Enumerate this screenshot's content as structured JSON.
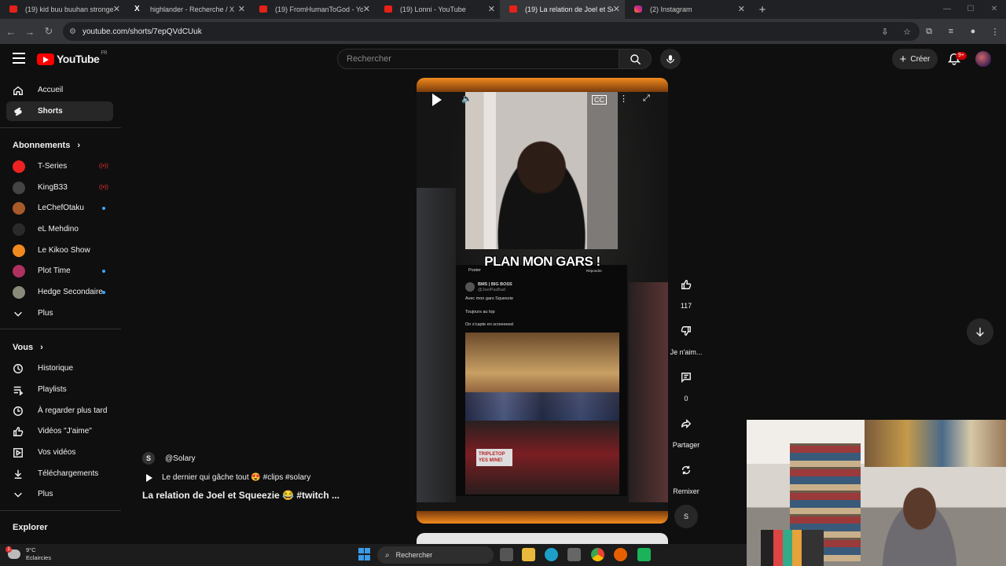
{
  "browser": {
    "tabs": [
      {
        "label": "(19) kid buu buuhan stronger -",
        "favicon": "youtube-icon",
        "active": false
      },
      {
        "label": "highlander - Recherche / X",
        "favicon": "x-icon",
        "active": false
      },
      {
        "label": "(19) FromHumanToGod - YouTu",
        "favicon": "youtube-icon",
        "active": false
      },
      {
        "label": "(19) Lonni - YouTube",
        "favicon": "youtube-icon",
        "active": false
      },
      {
        "label": "(19) La relation de Joel et Sque",
        "favicon": "youtube-icon",
        "active": true
      },
      {
        "label": "(2) Instagram",
        "favicon": "instagram-icon",
        "active": false
      }
    ],
    "new_tab_glyph": "+",
    "url": "youtube.com/shorts/7epQVdCUuk"
  },
  "header": {
    "logo_text": "YouTube",
    "country_code": "FR",
    "search_placeholder": "Rechercher",
    "create_label": "Créer",
    "notification_badge": "9+"
  },
  "sidebar": {
    "main": [
      {
        "label": "Accueil",
        "icon": "home-icon"
      },
      {
        "label": "Shorts",
        "icon": "shorts-icon",
        "active": true
      }
    ],
    "subscriptions_title": "Abonnements",
    "subscriptions": [
      {
        "label": "T-Series",
        "status": "live",
        "color": "#e22"
      },
      {
        "label": "KingB33",
        "status": "live",
        "color": "#444"
      },
      {
        "label": "LeChefOtaku",
        "status": "new",
        "color": "#a85a2a"
      },
      {
        "label": "eL Mehdino",
        "status": "",
        "color": "#2a2a2a"
      },
      {
        "label": "Le Kikoo Show",
        "status": "",
        "color": "#f08a1e"
      },
      {
        "label": "Plot Time",
        "status": "new",
        "color": "#b03060"
      },
      {
        "label": "Hedge Secondaire",
        "status": "new",
        "color": "#8a8a7a"
      }
    ],
    "subscriptions_more": "Plus",
    "you_title": "Vous",
    "you_items": [
      {
        "label": "Historique",
        "icon": "history-icon"
      },
      {
        "label": "Playlists",
        "icon": "playlists-icon"
      },
      {
        "label": "À regarder plus tard",
        "icon": "watch-later-icon"
      },
      {
        "label": "Vidéos \"J'aime\"",
        "icon": "liked-icon"
      },
      {
        "label": "Vos vidéos",
        "icon": "your-videos-icon"
      },
      {
        "label": "Téléchargements",
        "icon": "download-icon"
      }
    ],
    "you_more": "Plus",
    "explore_title": "Explorer"
  },
  "short": {
    "caption": "PLAN MON GARS !",
    "tweet": {
      "header": "Poster",
      "reply": "Répondre",
      "name": "BMS | BIG BOSS",
      "handle": "@JoelPasBad",
      "line1": "Avec mon gars Squeezie",
      "line2": "Toujours au top",
      "line3": "On s'capte en screeeeed"
    },
    "channel": "@Solary",
    "playlist": "Le dernier qui gâche tout 😍 #clips #solary",
    "title": "La relation de Joel et Squeezie 😂 #twitch ..."
  },
  "actions": {
    "likes": "117",
    "dislike_label": "Je n'aim...",
    "comments": "0",
    "share_label": "Partager",
    "remix_label": "Remixer"
  },
  "taskbar": {
    "temperature": "9°C",
    "weather": "Eclaircies",
    "search_label": "Rechercher"
  }
}
